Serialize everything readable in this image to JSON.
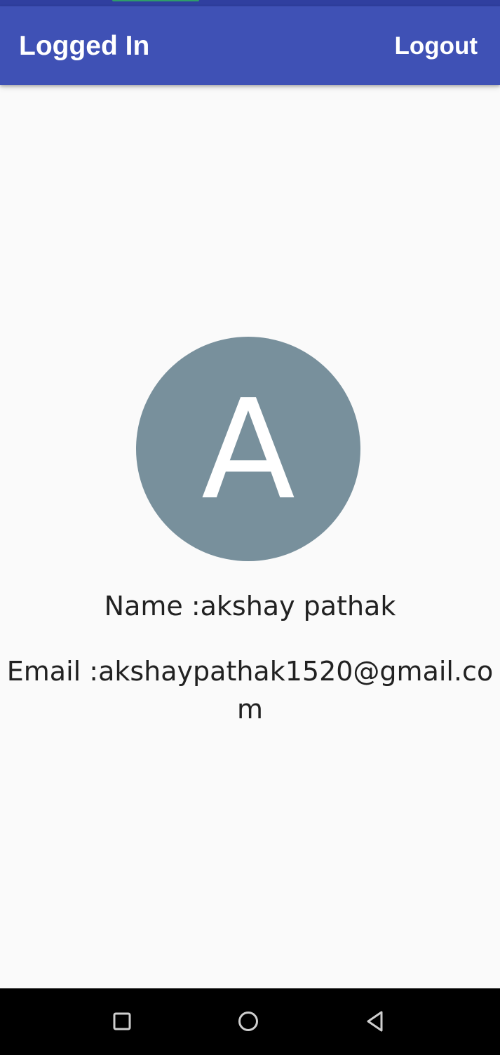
{
  "app_bar": {
    "title": "Logged In",
    "logout_label": "Logout",
    "color": "#3f51b5"
  },
  "status_bar": {
    "color": "#303f9f"
  },
  "profile": {
    "avatar_letter": "A",
    "avatar_color": "#78909c",
    "name_line": "Name :akshay pathak",
    "email_line": "Email :akshaypathak1520@gmail.com"
  },
  "nav_bar": {
    "buttons": [
      "recents-icon",
      "home-icon",
      "back-icon"
    ]
  }
}
